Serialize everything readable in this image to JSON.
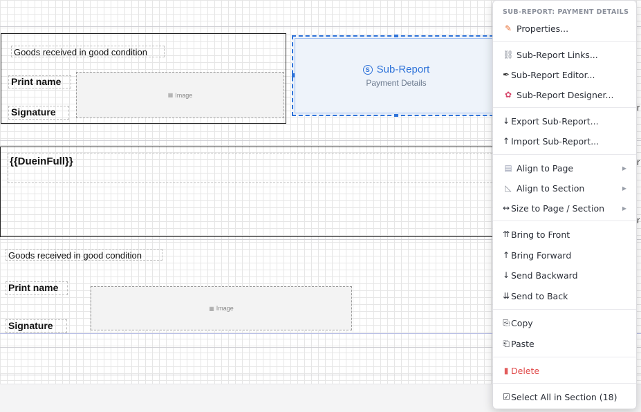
{
  "report": {
    "block1": {
      "received_text": "Goods received in good condition",
      "print_name": "Print name",
      "signature": "Signature",
      "image_label": "Image"
    },
    "subreport": {
      "title": "Sub-Report",
      "subtitle": "Payment Details"
    },
    "due_field": "{{DueinFull}}",
    "block2": {
      "received_text": "Goods received in good condition",
      "print_name": "Print name",
      "signature": "Signature",
      "image_label": "Image"
    },
    "edge_letters": [
      "r",
      "r",
      "r"
    ]
  },
  "menu": {
    "header": "SUB-REPORT: PAYMENT DETAILS",
    "items": [
      {
        "label": "Properties...",
        "icon": "pencil-icon"
      },
      {
        "label": "Sub-Report Links...",
        "icon": "link-icon"
      },
      {
        "label": "Sub-Report Editor...",
        "icon": "pen-icon"
      },
      {
        "label": "Sub-Report Designer...",
        "icon": "palette-icon"
      },
      {
        "label": "Export Sub-Report...",
        "icon": "arrow-down-icon"
      },
      {
        "label": "Import Sub-Report...",
        "icon": "arrow-up-icon"
      },
      {
        "label": "Align to Page",
        "icon": "page-icon",
        "submenu": true
      },
      {
        "label": "Align to Section",
        "icon": "triangle-ruler-icon",
        "submenu": true
      },
      {
        "label": "Size to Page / Section",
        "icon": "resize-icon",
        "submenu": true
      },
      {
        "label": "Bring to Front",
        "icon": "double-up-icon"
      },
      {
        "label": "Bring Forward",
        "icon": "up-icon"
      },
      {
        "label": "Send Backward",
        "icon": "down-icon"
      },
      {
        "label": "Send to Back",
        "icon": "double-down-icon"
      },
      {
        "label": "Copy",
        "icon": "copy-icon"
      },
      {
        "label": "Paste",
        "icon": "paste-icon"
      },
      {
        "label": "Delete",
        "icon": "trash-icon"
      },
      {
        "label": "Select All in Section (18)",
        "icon": "checkbox-icon"
      }
    ]
  }
}
